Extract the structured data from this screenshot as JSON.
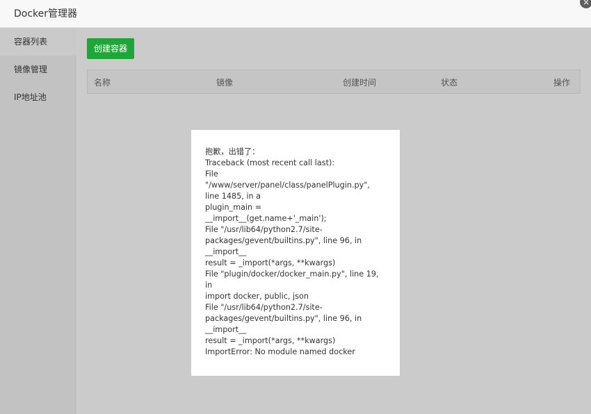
{
  "window": {
    "title": "Docker管理器",
    "close_icon": "×"
  },
  "sidebar": {
    "items": [
      {
        "label": "容器列表"
      },
      {
        "label": "镜像管理"
      },
      {
        "label": "IP地址池"
      }
    ]
  },
  "main": {
    "create_button": "创建容器",
    "table": {
      "columns": [
        "名称",
        "镜像",
        "创建时间",
        "状态",
        "操作"
      ]
    }
  },
  "error": {
    "lines": [
      "抱歉，出错了：",
      "Traceback (most recent call last):",
      "File",
      "\"/www/server/panel/class/panelPlugin.py\",",
      "line 1485, in a",
      "plugin_main =",
      "__import__(get.name+'_main');",
      "File \"/usr/lib64/python2.7/site-",
      "packages/gevent/builtins.py\", line 96, in",
      "__import__",
      "result = _import(*args, **kwargs)",
      "File \"plugin/docker/docker_main.py\", line 19,",
      "in",
      "import docker, public, json",
      "File \"/usr/lib64/python2.7/site-",
      "packages/gevent/builtins.py\", line 96, in",
      "__import__",
      "result = _import(*args, **kwargs)",
      "ImportError: No module named docker"
    ]
  },
  "colors": {
    "accent": "#20a53a",
    "overlay": "#c9c9c9"
  }
}
